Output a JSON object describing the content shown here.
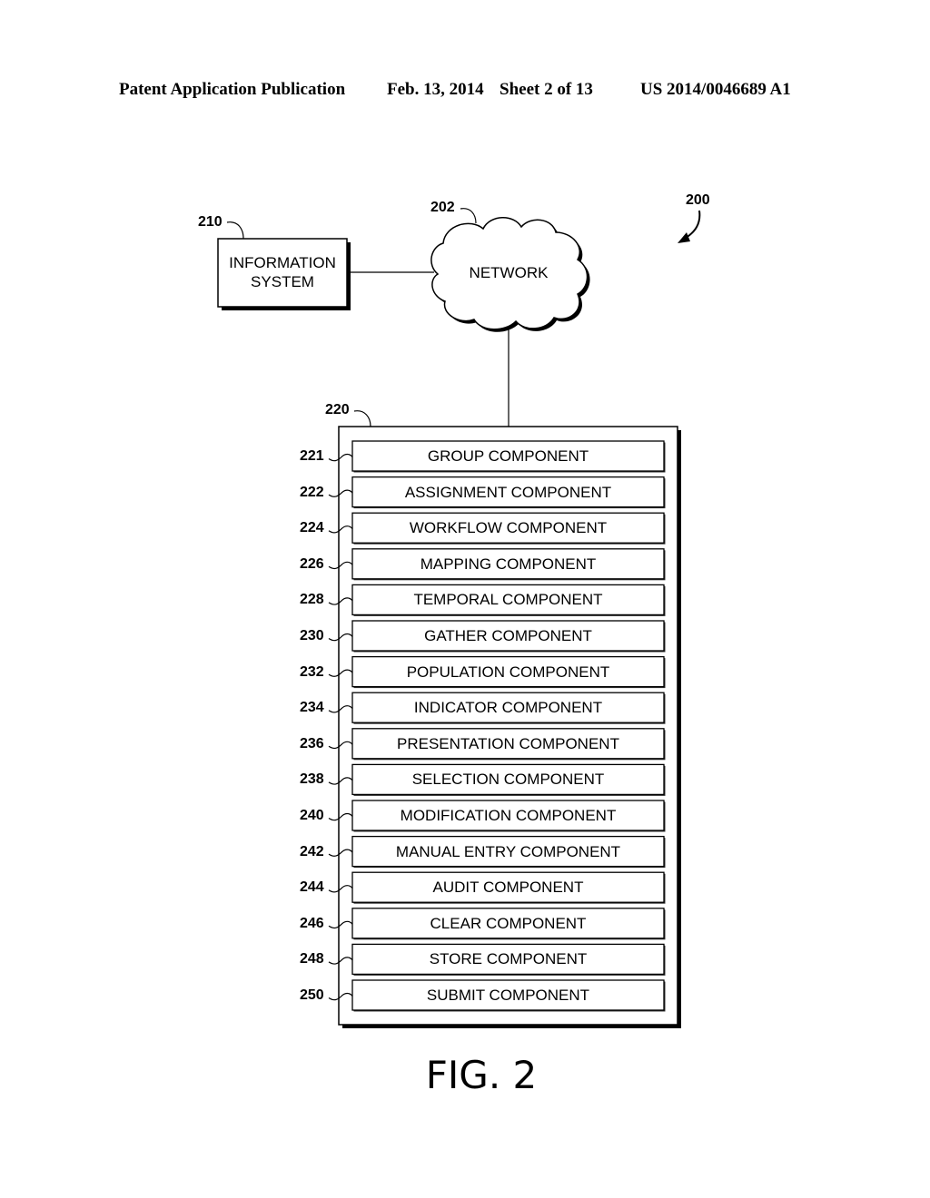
{
  "header": {
    "publication": "Patent Application Publication",
    "date": "Feb. 13, 2014",
    "sheet": "Sheet 2 of 13",
    "number": "US 2014/0046689 A1"
  },
  "diagram": {
    "system_ref": "200",
    "network": {
      "ref": "202",
      "label": "NETWORK"
    },
    "information_system": {
      "ref": "210",
      "label_line1": "INFORMATION",
      "label_line2": "SYSTEM"
    },
    "container": {
      "ref": "220"
    },
    "components": [
      {
        "ref": "221",
        "label": "GROUP COMPONENT"
      },
      {
        "ref": "222",
        "label": "ASSIGNMENT COMPONENT"
      },
      {
        "ref": "224",
        "label": "WORKFLOW COMPONENT"
      },
      {
        "ref": "226",
        "label": "MAPPING COMPONENT"
      },
      {
        "ref": "228",
        "label": "TEMPORAL COMPONENT"
      },
      {
        "ref": "230",
        "label": "GATHER COMPONENT"
      },
      {
        "ref": "232",
        "label": "POPULATION COMPONENT"
      },
      {
        "ref": "234",
        "label": "INDICATOR COMPONENT"
      },
      {
        "ref": "236",
        "label": "PRESENTATION COMPONENT"
      },
      {
        "ref": "238",
        "label": "SELECTION COMPONENT"
      },
      {
        "ref": "240",
        "label": "MODIFICATION COMPONENT"
      },
      {
        "ref": "242",
        "label": "MANUAL ENTRY COMPONENT"
      },
      {
        "ref": "244",
        "label": "AUDIT COMPONENT"
      },
      {
        "ref": "246",
        "label": "CLEAR COMPONENT"
      },
      {
        "ref": "248",
        "label": "STORE COMPONENT"
      },
      {
        "ref": "250",
        "label": "SUBMIT COMPONENT"
      }
    ]
  },
  "figure_label": "FIG. 2"
}
